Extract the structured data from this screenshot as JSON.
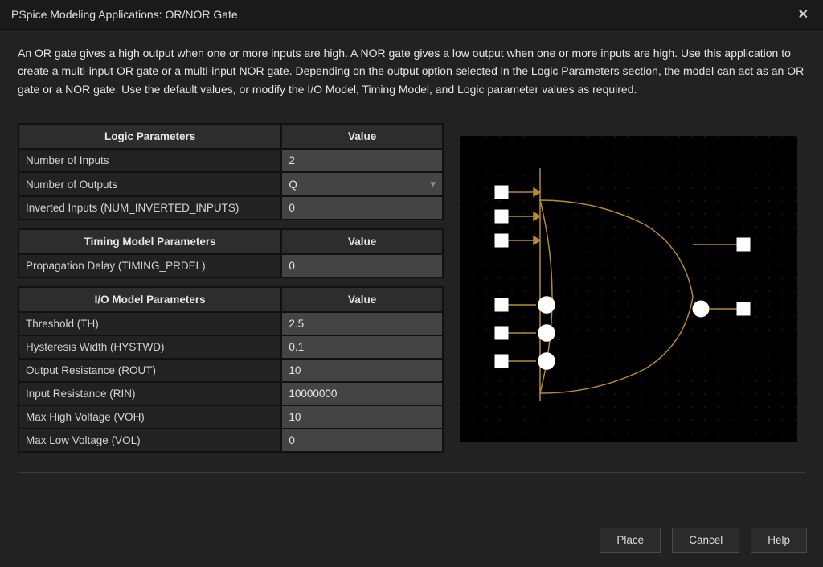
{
  "window": {
    "title": "PSpice Modeling Applications: OR/NOR Gate"
  },
  "description": "An OR gate gives a high output when one or more inputs are high. A NOR gate gives a low output when one or more inputs are high. Use this application to create a multi-input OR gate or a multi-input NOR gate. Depending on the output option selected in the Logic Parameters section, the model can act as an OR gate or a NOR gate. Use the default values, or modify the I/O Model, Timing Model, and Logic parameter values as required.",
  "headers": {
    "logic": "Logic Parameters",
    "timing": "Timing Model Parameters",
    "io": "I/O Model Parameters",
    "value": "Value"
  },
  "logic": {
    "num_inputs": {
      "label": "Number of Inputs",
      "value": "2"
    },
    "num_outputs": {
      "label": "Number of Outputs",
      "value": "Q"
    },
    "inverted": {
      "label": "Inverted Inputs (NUM_INVERTED_INPUTS)",
      "value": "0"
    }
  },
  "timing": {
    "prdel": {
      "label": "Propagation Delay (TIMING_PRDEL)",
      "value": "0"
    }
  },
  "io": {
    "th": {
      "label": "Threshold (TH)",
      "value": "2.5"
    },
    "hystwd": {
      "label": "Hysteresis Width (HYSTWD)",
      "value": "0.1"
    },
    "rout": {
      "label": "Output Resistance (ROUT)",
      "value": "10"
    },
    "rin": {
      "label": "Input Resistance (RIN)",
      "value": "10000000"
    },
    "voh": {
      "label": "Max High Voltage (VOH)",
      "value": "10"
    },
    "vol": {
      "label": "Max Low Voltage (VOL)",
      "value": "0"
    }
  },
  "buttons": {
    "place": "Place",
    "cancel": "Cancel",
    "help": "Help"
  }
}
